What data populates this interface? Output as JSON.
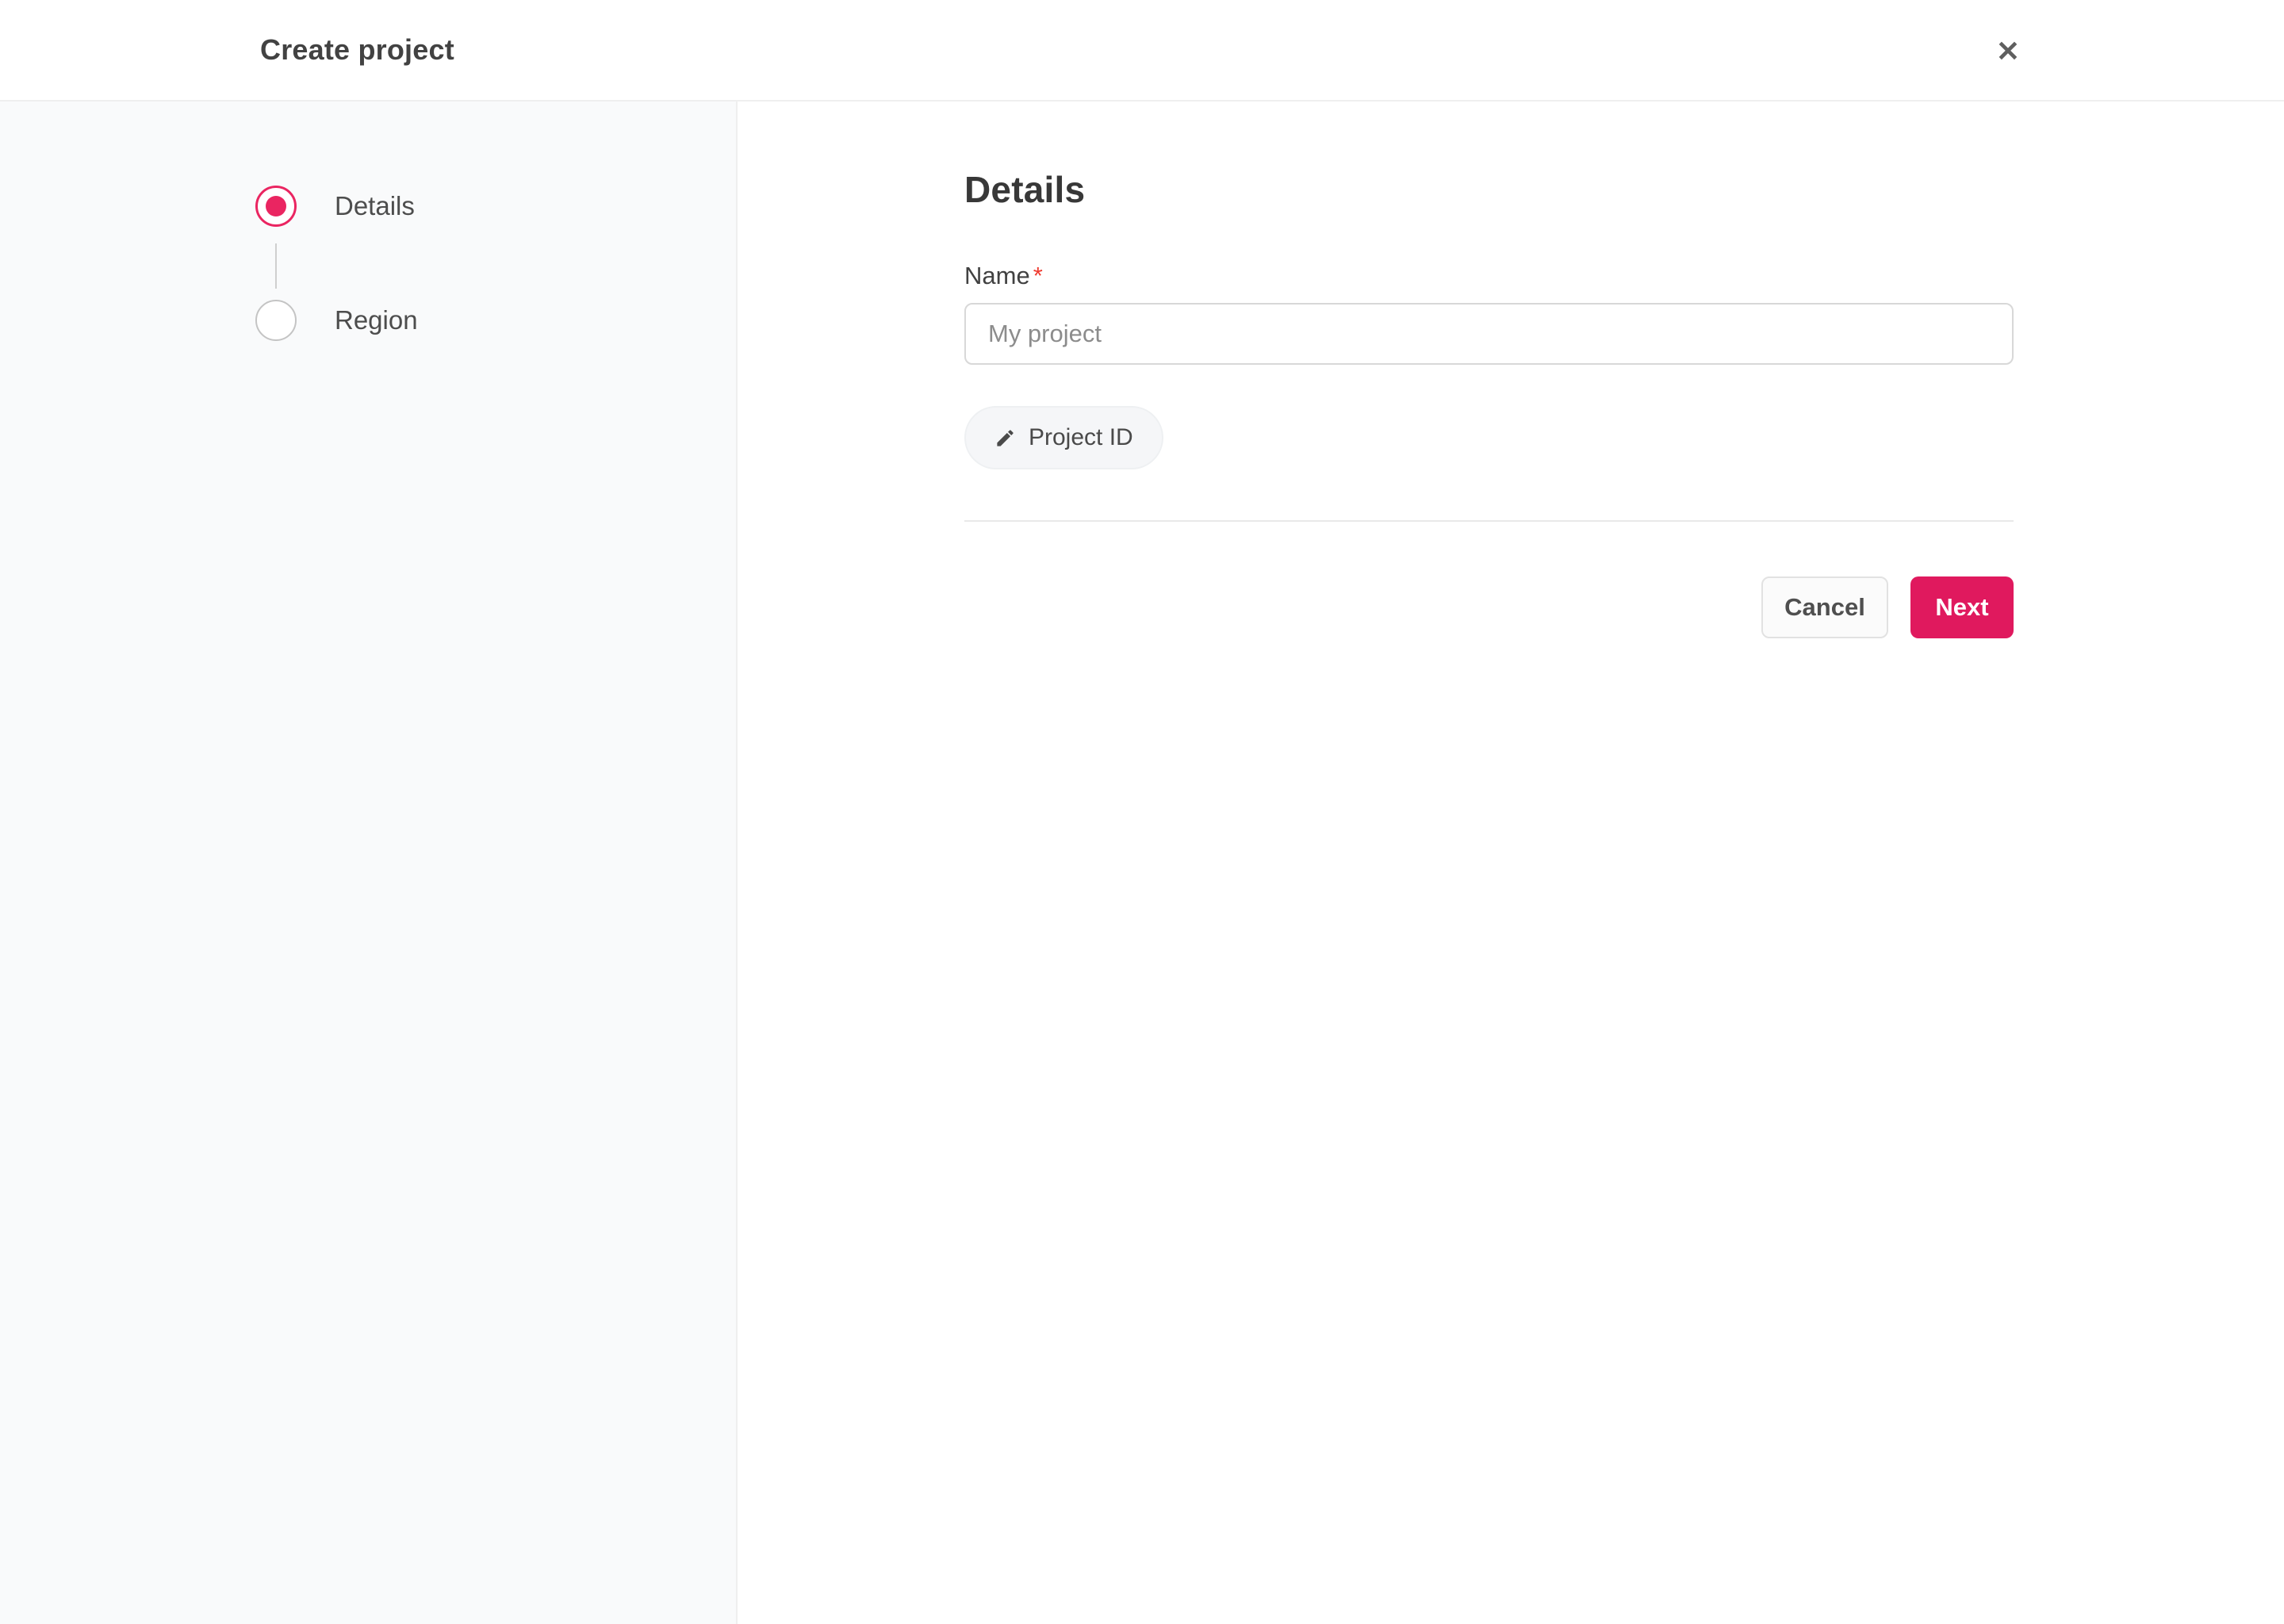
{
  "header": {
    "title": "Create project",
    "close_glyph": "✕"
  },
  "stepper": {
    "steps": [
      {
        "label": "Details",
        "state": "active"
      },
      {
        "label": "Region",
        "state": "inactive"
      }
    ]
  },
  "main": {
    "heading": "Details",
    "form": {
      "name_label": "Name",
      "required_marker": "*",
      "name_value": "",
      "name_placeholder": "My project"
    },
    "project_id_button": {
      "label": "Project ID",
      "icon": "pencil-icon"
    },
    "actions": {
      "cancel_label": "Cancel",
      "next_label": "Next"
    }
  },
  "colors": {
    "accent": "#e0195e",
    "radio_active": "#ea2561",
    "required": "#ef3b30",
    "sidebar_bg": "#f9fafb",
    "border": "#efefef"
  }
}
